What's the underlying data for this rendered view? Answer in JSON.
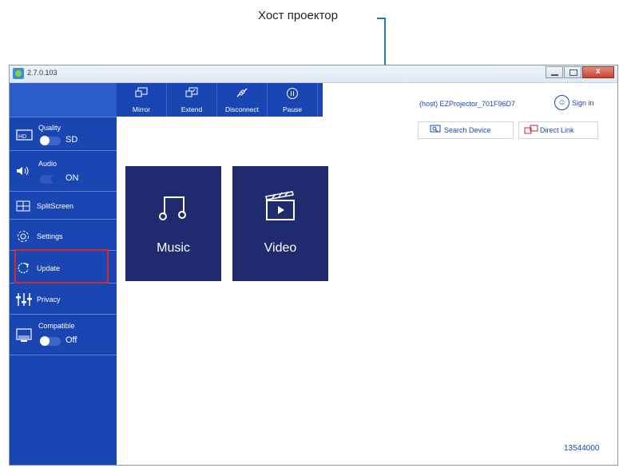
{
  "annotation": {
    "label": "Хост проектор"
  },
  "window": {
    "version": "2.7.0.103"
  },
  "toolbar": {
    "items": [
      {
        "label": "Mirror",
        "icon": "mirror-icon"
      },
      {
        "label": "Extend",
        "icon": "extend-icon"
      },
      {
        "label": "Disconnect",
        "icon": "disconnect-icon"
      },
      {
        "label": "Pause",
        "icon": "pause-icon"
      }
    ]
  },
  "header": {
    "device": "(host) EZProjector_701F96D7",
    "signin": "Sign in",
    "search_device": "Search Device",
    "direct_link": "Direct Link"
  },
  "sidebar": {
    "quality": {
      "label": "Quality",
      "value": "SD"
    },
    "audio": {
      "label": "Audio",
      "value": "ON"
    },
    "splitscreen": {
      "label": "SplitScreen"
    },
    "settings": {
      "label": "Settings"
    },
    "update": {
      "label": "Update"
    },
    "privacy": {
      "label": "Privacy"
    },
    "compatible": {
      "label": "Compatible",
      "value": "Off"
    }
  },
  "main": {
    "music": {
      "label": "Music"
    },
    "video": {
      "label": "Video"
    }
  },
  "footer": {
    "id": "13544000"
  },
  "colors": {
    "accent": "#1a46b4",
    "tile": "#1f2b6e",
    "highlight": "#d32a2a",
    "callout_line": "#1e7bc0"
  }
}
